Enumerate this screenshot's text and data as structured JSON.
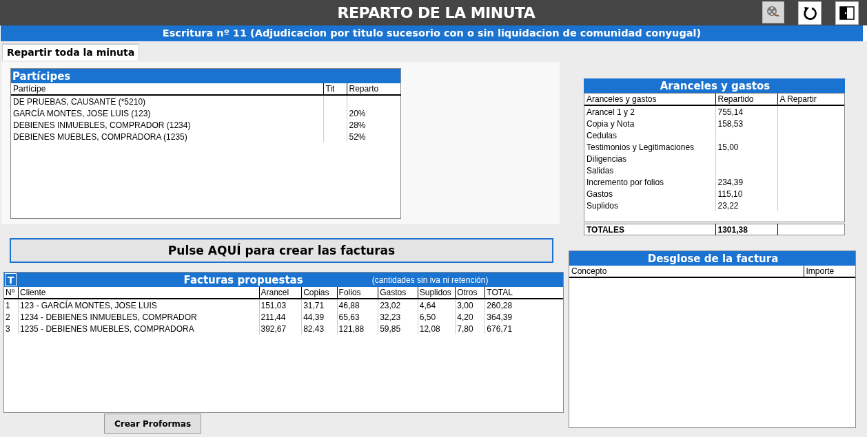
{
  "window": {
    "title": "REPARTO DE LA MINUTA"
  },
  "toolbar": [
    {
      "kind": "film",
      "pressed": true
    },
    {
      "kind": "undo",
      "pressed": false
    },
    {
      "kind": "exit",
      "pressed": false
    }
  ],
  "subtitle": "Escritura nº 11 (Adjudicacion por titulo sucesorio con o sin liquidacion de comunidad conyugal)",
  "tabs": [
    {
      "label": "Repartir toda la minuta",
      "selected": true
    }
  ],
  "participes": {
    "title": "Partícipes",
    "columns": [
      "Partícipe",
      "Tit",
      "Reparto"
    ],
    "rows": [
      {
        "participe": "DE PRUEBAS, CAUSANTE (*5210)"
      },
      {
        "participe": "GARCÍA MONTES, JOSE LUIS (123)",
        "reparto": "20%"
      },
      {
        "participe": "DEBIENES INMUEBLES, COMPRADOR (1234)",
        "reparto": "28%"
      },
      {
        "participe": "DEBIENES MUEBLES, COMPRADORA (1235)",
        "reparto": "52%"
      }
    ]
  },
  "aranceles": {
    "title": "Aranceles y gastos",
    "columns": [
      "Aranceles y gastos",
      "Repartido",
      "A Repartir"
    ],
    "rows": [
      {
        "concepto": "Arancel 1 y 2",
        "repartido": "755,14"
      },
      {
        "concepto": "Copia y Nota",
        "repartido": "158,53"
      },
      {
        "concepto": "Cedulas"
      },
      {
        "concepto": "Testimonios y Legitimaciones",
        "repartido": "15,00"
      },
      {
        "concepto": "Diligencias"
      },
      {
        "concepto": "Salidas"
      },
      {
        "concepto": "Incremento por folios",
        "repartido": "234,39"
      },
      {
        "concepto": "Gastos",
        "repartido": "115,10"
      },
      {
        "concepto": "Suplidos",
        "repartido": "23,22"
      }
    ],
    "totals": {
      "label": "TOTALES",
      "repartido": "1301,38"
    }
  },
  "create_invoices_button": "Pulse AQUÍ para crear las facturas",
  "facturas": {
    "t_button": "T",
    "title": "Facturas propuestas",
    "note": "(cantidades sin iva ni retención)",
    "columns": [
      "Nº",
      "Cliente",
      "Arancel",
      "Copias",
      "Folios",
      "Gastos",
      "Suplidos",
      "Otros",
      "TOTAL"
    ],
    "rows": [
      [
        "1",
        "123 - GARCÍA MONTES, JOSE LUIS",
        "151,03",
        "31,71",
        "46,88",
        "23,02",
        "4,64",
        "3,00",
        "260,28"
      ],
      [
        "2",
        "1234 - DEBIENES INMUEBLES, COMPRADOR",
        "211,44",
        "44,39",
        "65,63",
        "32,23",
        "6,50",
        "4,20",
        "364,39"
      ],
      [
        "3",
        "1235 - DEBIENES MUEBLES, COMPRADORA",
        "392,67",
        "82,43",
        "121,88",
        "59,85",
        "12,08",
        "7,80",
        "676,71"
      ]
    ]
  },
  "proformas_button": "Crear Proformas",
  "desglose": {
    "title": "Desglose de la factura",
    "columns": [
      "Concepto",
      "Importe"
    ]
  }
}
